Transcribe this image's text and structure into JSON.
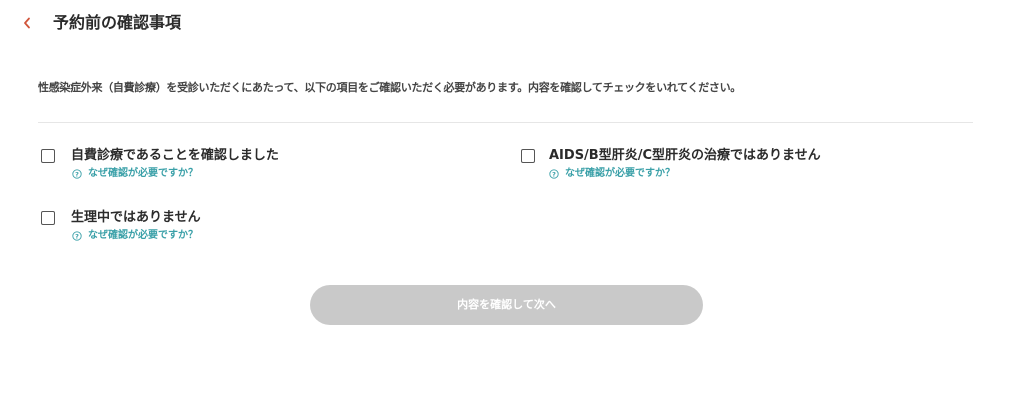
{
  "header": {
    "back_icon": "chevron-left-icon",
    "title": "予約前の確認事項"
  },
  "intro": {
    "text": "性感染症外来（自費診療）を受診いただくにあたって、以下の項目をご確認いただく必要があります。内容を確認してチェックをいれてください。"
  },
  "checklist": {
    "items": [
      {
        "label": "自費診療であることを確認しました",
        "checked": false,
        "help_text": "なぜ確認が必要ですか？"
      },
      {
        "label": "AIDS/B型肝炎/C型肝炎の治療ではありません",
        "checked": false,
        "help_text": "なぜ確認が必要ですか？"
      },
      {
        "label": "生理中ではありません",
        "checked": false,
        "help_text": "なぜ確認が必要ですか？"
      }
    ]
  },
  "submit": {
    "label": "内容を確認して次へ",
    "enabled": false
  },
  "colors": {
    "accent_back": "#d0543a",
    "help_link": "#3aa0a8",
    "button_disabled": "#c9c9c9"
  }
}
